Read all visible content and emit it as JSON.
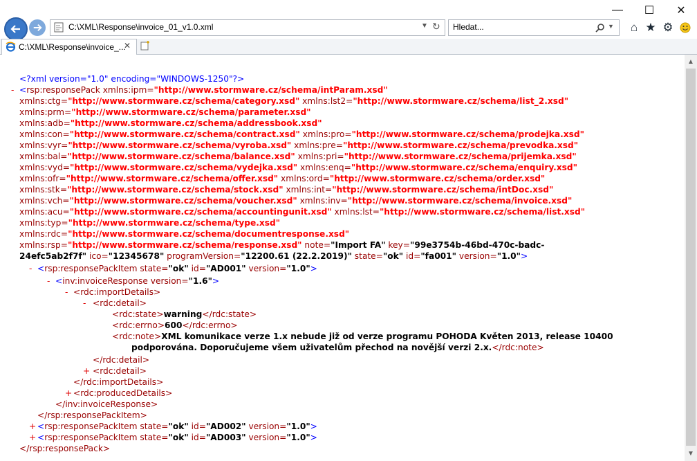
{
  "window": {
    "controls": {
      "minimize": "—",
      "maximize": "☐",
      "close": "✕"
    }
  },
  "nav": {
    "address": "C:\\XML\\Response\\invoice_01_v1.0.xml",
    "search_placeholder": "Hledat...",
    "icons": [
      "back-icon",
      "forward-icon",
      "home-icon",
      "favorites-icon",
      "settings-icon",
      "smiley-icon"
    ]
  },
  "tab": {
    "label": "C:\\XML\\Response\\invoice_..."
  },
  "xml": {
    "l01": "<?xml version=\"1.0\" encoding=\"WINDOWS-1250\"?>",
    "toggle_minus": "-",
    "toggle_plus": "+",
    "rsp_open": "<rsp:responsePack",
    "ns_ipm": "xmlns:ipm=",
    "url_intParam": "\"http://www.stormware.cz/schema/intParam.xsd\"",
    "ns_ctg": "xmlns:ctg=",
    "url_category": "\"http://www.stormware.cz/schema/category.xsd\"",
    "ns_lst2": "xmlns:lst2=",
    "url_list2": "\"http://www.stormware.cz/schema/list_2.xsd\"",
    "ns_prm": "xmlns:prm=",
    "url_parameter": "\"http://www.stormware.cz/schema/parameter.xsd\"",
    "ns_adb": "xmlns:adb=",
    "url_addressbook": "\"http://www.stormware.cz/schema/addressbook.xsd\"",
    "ns_con": "xmlns:con=",
    "url_contract": "\"http://www.stormware.cz/schema/contract.xsd\"",
    "ns_pro": "xmlns:pro=",
    "url_prodejka": "\"http://www.stormware.cz/schema/prodejka.xsd\"",
    "ns_vyr": "xmlns:vyr=",
    "url_vyroba": "\"http://www.stormware.cz/schema/vyroba.xsd\"",
    "ns_pre": "xmlns:pre=",
    "url_prevodka": "\"http://www.stormware.cz/schema/prevodka.xsd\"",
    "ns_bal": "xmlns:bal=",
    "url_balance": "\"http://www.stormware.cz/schema/balance.xsd\"",
    "ns_pri": "xmlns:pri=",
    "url_prijemka": "\"http://www.stormware.cz/schema/prijemka.xsd\"",
    "ns_vyd": "xmlns:vyd=",
    "url_vydejka": "\"http://www.stormware.cz/schema/vydejka.xsd\"",
    "ns_enq": "xmlns:enq=",
    "url_enquiry": "\"http://www.stormware.cz/schema/enquiry.xsd\"",
    "ns_ofr": "xmlns:ofr=",
    "url_offer": "\"http://www.stormware.cz/schema/offer.xsd\"",
    "ns_ord": "xmlns:ord=",
    "url_order": "\"http://www.stormware.cz/schema/order.xsd\"",
    "ns_stk": "xmlns:stk=",
    "url_stock": "\"http://www.stormware.cz/schema/stock.xsd\"",
    "ns_int": "xmlns:int=",
    "url_intDoc": "\"http://www.stormware.cz/schema/intDoc.xsd\"",
    "ns_vch": "xmlns:vch=",
    "url_voucher": "\"http://www.stormware.cz/schema/voucher.xsd\"",
    "ns_inv": "xmlns:inv=",
    "url_invoice": "\"http://www.stormware.cz/schema/invoice.xsd\"",
    "ns_acu": "xmlns:acu=",
    "url_accountingunit": "\"http://www.stormware.cz/schema/accountingunit.xsd\"",
    "ns_lst": "xmlns:lst=",
    "url_list": "\"http://www.stormware.cz/schema/list.xsd\"",
    "ns_typ": "xmlns:typ=",
    "url_type": "\"http://www.stormware.cz/schema/type.xsd\"",
    "ns_rdc": "xmlns:rdc=",
    "url_documentresponse": "\"http://www.stormware.cz/schema/documentresponse.xsd\"",
    "ns_rsp": "xmlns:rsp=",
    "url_response": "\"http://www.stormware.cz/schema/response.xsd\"",
    "attr_note": " note=",
    "val_note": "\"Import FA\"",
    "attr_key": " key=",
    "val_key1": "\"99e3754b-46bd-470c-badc-",
    "val_key2": "24efc5ab2f7f\"",
    "attr_ico": " ico=",
    "val_ico": "\"12345678\"",
    "attr_progver": " programVersion=",
    "val_progver": "\"12200.61 (22.2.2019)\"",
    "attr_state": " state=",
    "val_ok": "\"ok\"",
    "attr_id": " id=",
    "val_fa001": "\"fa001\"",
    "attr_version": " version=",
    "val_10": "\"1.0\"",
    "close_gt": ">",
    "item_open": "<rsp:responsePackItem",
    "val_ad001": "\"AD001\"",
    "val_ad002": "\"AD002\"",
    "val_ad003": "\"AD003\"",
    "inv_open": "<inv:invoiceResponse",
    "val_16": "\"1.6\"",
    "import_open": "<rdc:importDetails>",
    "detail_open": "<rdc:detail>",
    "state_open": "<rdc:state>",
    "state_val": "warning",
    "state_close": "</rdc:state>",
    "errno_open": "<rdc:errno>",
    "errno_val": "600",
    "errno_close": "</rdc:errno>",
    "note_open": "<rdc:note>",
    "note_val1": "XML komunikace verze 1.x nebude již od verze programu POHODA Květen 2013, release 10400",
    "note_val2": "podporována. Doporučujeme všem uživatelům přechod na novější verzi 2.x.",
    "note_close": "</rdc:note>",
    "detail_close": "</rdc:detail>",
    "detail_collapsed": "<rdc:detail>",
    "import_close": "</rdc:importDetails>",
    "produced_collapsed": "<rdc:producedDetails>",
    "inv_close": "</inv:invoiceResponse>",
    "item_close": "</rsp:responsePackItem>",
    "rsp_close": "</rsp:responsePack>"
  }
}
